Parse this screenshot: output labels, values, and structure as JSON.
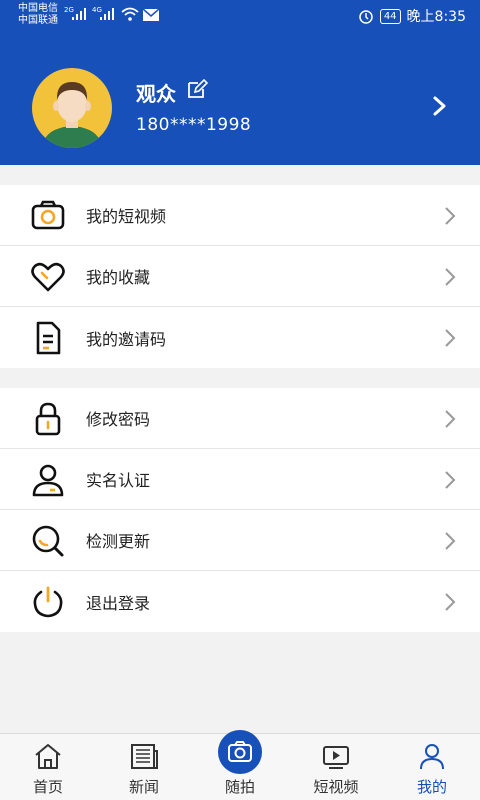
{
  "status_bar": {
    "carrier1": "中国电信",
    "carrier2": "中国联通",
    "net1": "2G",
    "net2": "4G",
    "battery": "44",
    "time": "晚上8:35"
  },
  "profile": {
    "name": "观众",
    "phone": "180****1998"
  },
  "menu_group1": [
    {
      "label": "我的短视频",
      "icon": "camera-icon"
    },
    {
      "label": "我的收藏",
      "icon": "heart-icon"
    },
    {
      "label": "我的邀请码",
      "icon": "document-icon"
    }
  ],
  "menu_group2": [
    {
      "label": "修改密码",
      "icon": "lock-icon"
    },
    {
      "label": "实名认证",
      "icon": "user-icon"
    },
    {
      "label": "检测更新",
      "icon": "search-icon"
    },
    {
      "label": "退出登录",
      "icon": "power-icon"
    }
  ],
  "tabs": [
    {
      "label": "首页",
      "icon": "home-icon"
    },
    {
      "label": "新闻",
      "icon": "news-icon"
    },
    {
      "label": "随拍",
      "icon": "camera-icon"
    },
    {
      "label": "短视频",
      "icon": "video-icon"
    },
    {
      "label": "我的",
      "icon": "user-icon"
    }
  ],
  "colors": {
    "primary": "#1650b8",
    "accent": "#f5a623"
  }
}
